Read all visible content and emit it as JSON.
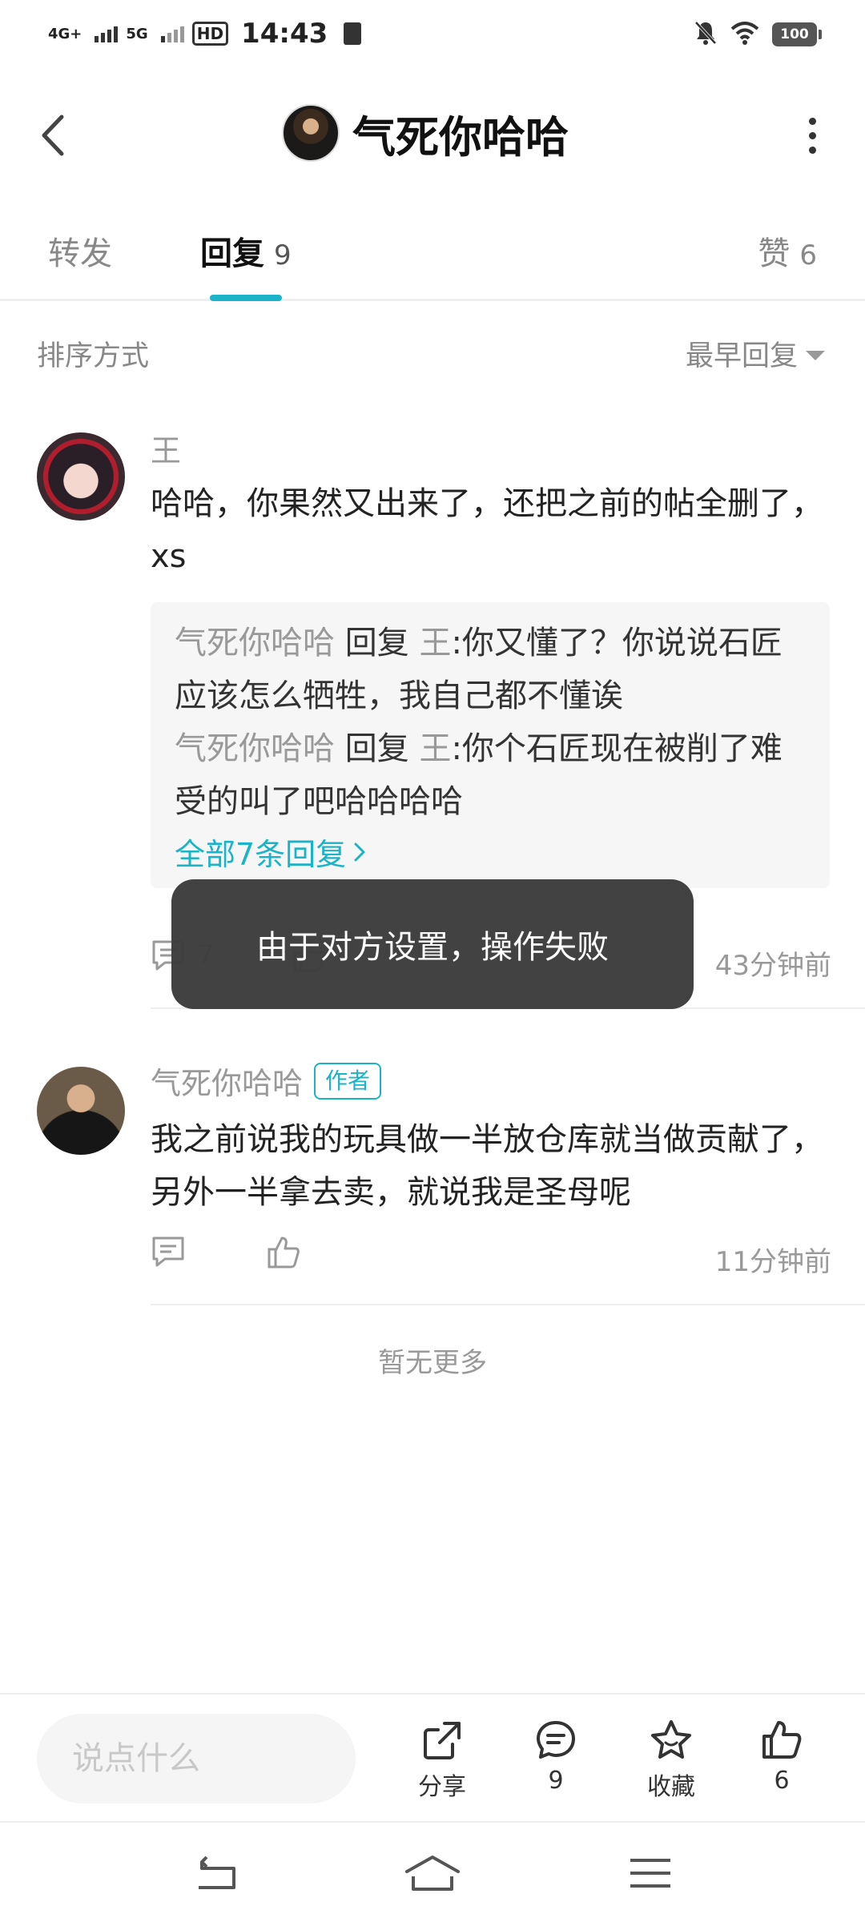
{
  "status_bar": {
    "network1": "4G+",
    "network2": "5G",
    "hd": "HD",
    "time": "14:43",
    "battery": "100"
  },
  "header": {
    "title": "气死你哈哈"
  },
  "tabs": {
    "forward": "转发",
    "reply": "回复",
    "reply_count": "9",
    "like": "赞",
    "like_count": "6"
  },
  "sort": {
    "label": "排序方式",
    "selected": "最早回复"
  },
  "comments": [
    {
      "user": "王",
      "text": "哈哈，你果然又出来了，还把之前的帖全删了，xs",
      "replies": [
        {
          "from": "气死你哈哈",
          "verb": "回复",
          "to": "王",
          "sep": ":",
          "text": "你又懂了？你说说石匠应该怎么牺牲，我自己都不懂诶"
        },
        {
          "from": "气死你哈哈",
          "verb": "回复",
          "to": "王",
          "sep": ":",
          "text": "你个石匠现在被削了难受的叫了吧哈哈哈哈"
        }
      ],
      "view_all": "全部7条回复",
      "reply_count": "7",
      "time": "43分钟前"
    },
    {
      "user": "气死你哈哈",
      "badge": "作者",
      "text": "我之前说我的玩具做一半放仓库就当做贡献了，另外一半拿去卖，就说我是圣母呢",
      "time": "11分钟前"
    }
  ],
  "no_more": "暂无更多",
  "toast": "由于对方设置，操作失败",
  "bottom_bar": {
    "input_placeholder": "说点什么",
    "share_label": "分享",
    "comment_count": "9",
    "favorite_label": "收藏",
    "like_count": "6"
  },
  "colors": {
    "accent": "#1ab3c7",
    "muted": "#999999",
    "toast_bg": "#3c3c3c"
  }
}
